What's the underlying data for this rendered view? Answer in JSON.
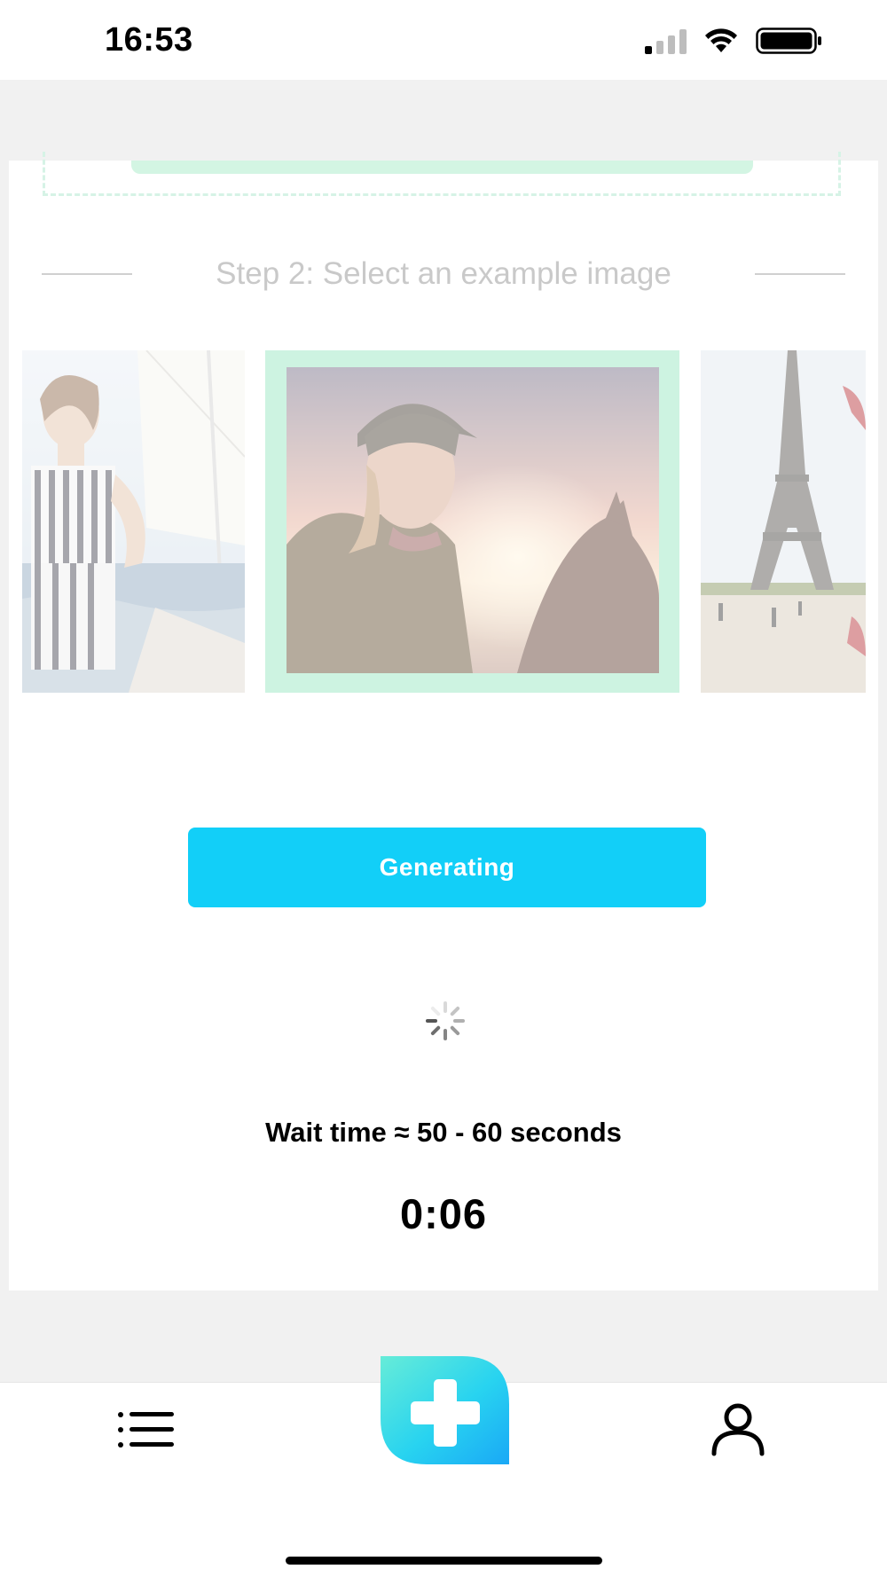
{
  "status_bar": {
    "time": "16:53",
    "icons": [
      "cellular-signal-icon",
      "wifi-icon",
      "battery-icon"
    ]
  },
  "step2": {
    "title": "Step 2: Select an example image"
  },
  "examples": [
    {
      "name": "woman-on-sailboat",
      "selected": false
    },
    {
      "name": "rider-with-horse-at-sunset",
      "selected": true
    },
    {
      "name": "eiffel-tower",
      "selected": false
    }
  ],
  "generate": {
    "label": "Generating",
    "color": "#12cff8"
  },
  "wait": {
    "text": "Wait time ≈ 50 - 60 seconds",
    "timer": "0:06"
  },
  "nav": {
    "items": [
      "list-icon",
      "add-icon",
      "profile-icon"
    ]
  },
  "colors": {
    "selection_border": "#cdf3e1",
    "accent": "#12cff8"
  }
}
